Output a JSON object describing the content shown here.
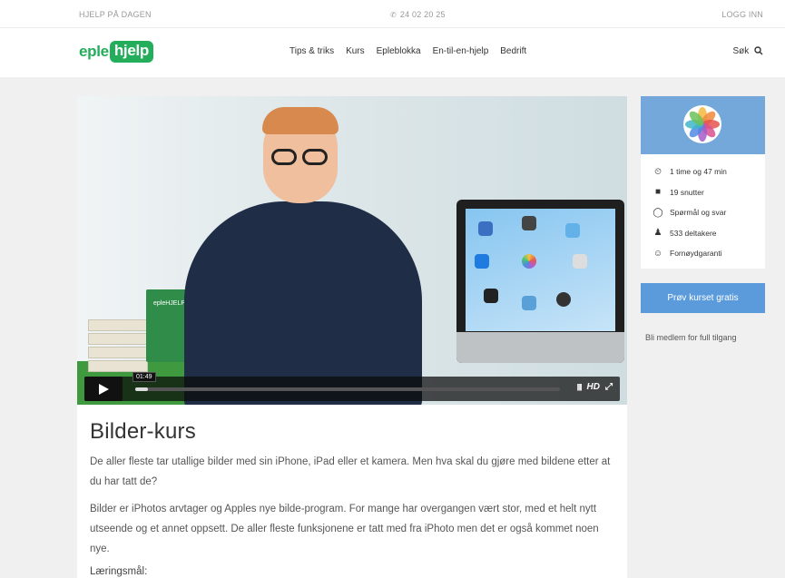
{
  "topbar": {
    "help": "HJELP PÅ DAGEN",
    "phone": "24 02 20 25",
    "login": "LOGG INN"
  },
  "logo": {
    "part1": "eple",
    "part2": "hjelp"
  },
  "nav": [
    "Tips & triks",
    "Kurs",
    "Epleblokka",
    "En-til-en-hjelp",
    "Bedrift"
  ],
  "search": "Søk",
  "video": {
    "book_label": "epleHJELP",
    "time": "01:49",
    "progress": 0.03,
    "hd": "HD"
  },
  "course": {
    "title": "Bilder-kurs",
    "para1": "De aller fleste tar utallige bilder med sin iPhone, iPad eller et kamera. Men hva skal du gjøre med bildene etter at du har tatt de?",
    "para2": "Bilder er iPhotos arvtager og Apples nye bilde-program. For mange har overgangen vært stor, med et helt nytt utseende og et annet oppsett. De aller fleste funksjonene er tatt med fra iPhoto men det er også kommet noen nye.",
    "para3": "Læringsmål:"
  },
  "sidebar": {
    "stats": [
      {
        "icon": "clock-icon",
        "text": "1 time og 47 min"
      },
      {
        "icon": "video-camera-icon",
        "text": "19 snutter"
      },
      {
        "icon": "speech-bubble-icon",
        "text": "Spørmål og svar"
      },
      {
        "icon": "person-icon",
        "text": "533 deltakere"
      },
      {
        "icon": "smiley-icon",
        "text": "Fornøydgaranti"
      }
    ],
    "cta": "Prøv kurset gratis",
    "member": "Bli medlem for full tilgang"
  },
  "colors": {
    "brand_green": "#24ad5b",
    "cta_blue": "#5b9bdc",
    "side_head": "#74a8db"
  }
}
